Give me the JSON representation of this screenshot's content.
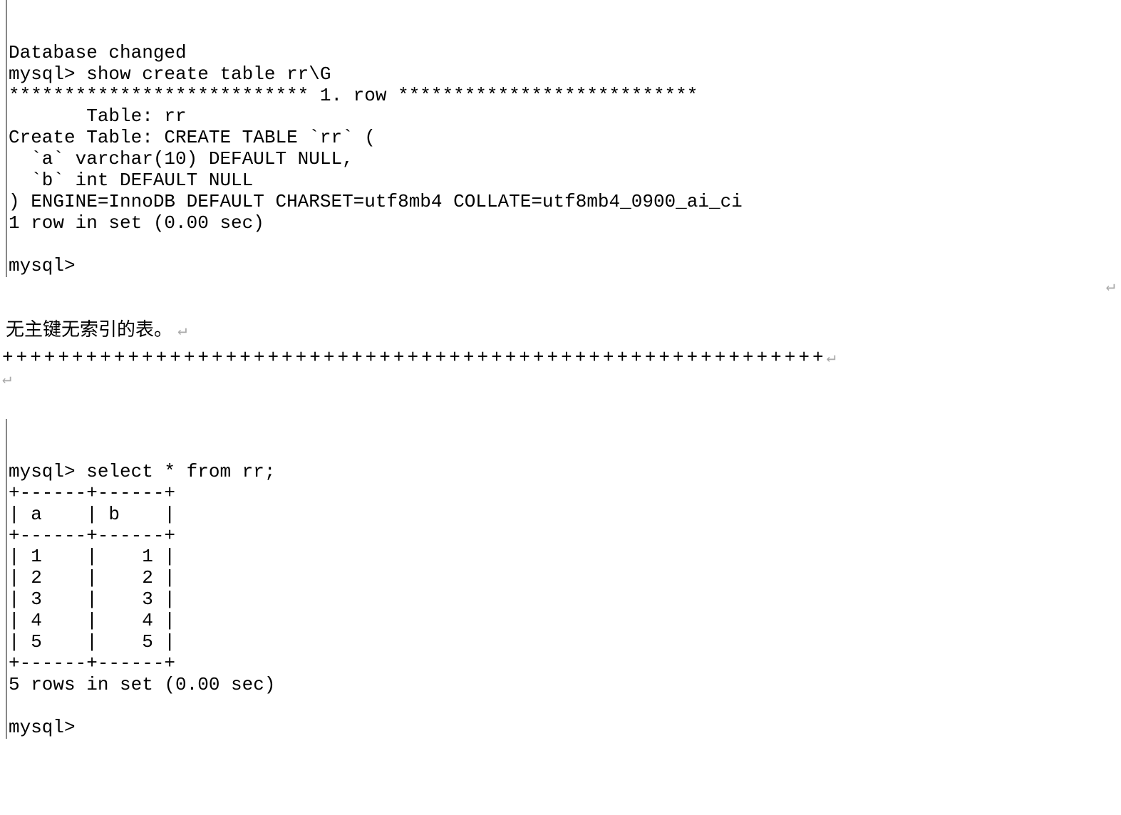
{
  "block1": {
    "l0": "",
    "l1": "Database changed",
    "l2": "mysql> show create table rr\\G",
    "l3": "*************************** 1. row ***************************",
    "l4": "       Table: rr",
    "l5": "Create Table: CREATE TABLE `rr` (",
    "l6": "  `a` varchar(10) DEFAULT NULL,",
    "l7": "  `b` int DEFAULT NULL",
    "l8": ") ENGINE=InnoDB DEFAULT CHARSET=utf8mb4 COLLATE=utf8mb4_0900_ai_ci",
    "l9": "1 row in set (0.00 sec)",
    "l10": "",
    "l11": "mysql>"
  },
  "narrative": {
    "text": "无主键无索引的表。"
  },
  "plus_line": "+++++++++++++++++++++++++++++++++++++++++++++++++++++++++++",
  "return_arrow": "↵",
  "block2": {
    "l0": "",
    "l1": "mysql> select * from rr;",
    "l2": "+------+------+",
    "l3": "| a    | b    |",
    "l4": "+------+------+",
    "l5": "| 1    |    1 |",
    "l6": "| 2    |    2 |",
    "l7": "| 3    |    3 |",
    "l8": "| 4    |    4 |",
    "l9": "| 5    |    5 |",
    "l10": "+------+------+",
    "l11": "5 rows in set (0.00 sec)",
    "l12": "",
    "l13": "mysql>"
  }
}
